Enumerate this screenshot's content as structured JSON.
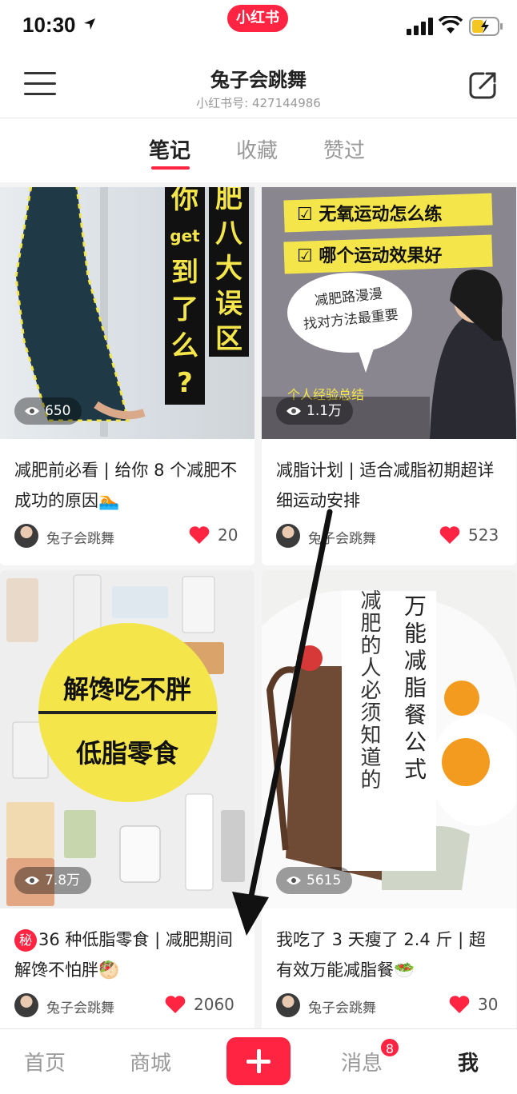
{
  "status_bar": {
    "time": "10:30",
    "brand": "小红书"
  },
  "header": {
    "name": "兔子会跳舞",
    "redbook_id": "小红书号: 427144986"
  },
  "tabs": [
    {
      "label": "笔记",
      "active": true
    },
    {
      "label": "收藏",
      "active": false
    },
    {
      "label": "赞过",
      "active": false
    }
  ],
  "cards": [
    {
      "views": "650",
      "title": "减肥前必看 | 给你 8 个减肥不成功的原因🏊",
      "author": "兔子会跳舞",
      "likes": "20",
      "cover_text": [
        "你",
        "get",
        "到",
        "了",
        "么",
        "?"
      ],
      "cover_text_b": [
        "肥",
        "八",
        "大",
        "误",
        "区"
      ]
    },
    {
      "views": "1.1万",
      "title": "减脂计划 | 适合减脂初期超详细运动安排",
      "author": "兔子会跳舞",
      "likes": "523",
      "cover_lines": [
        "无氧运动怎么练",
        "哪个运动效果好"
      ],
      "cover_bubble": [
        "减肥路漫漫",
        "找对方法最重要"
      ],
      "cover_footer": "个人经验总结"
    },
    {
      "views": "7.8万",
      "title_badge": "秘",
      "title": "36 种低脂零食 | 减肥期间解馋不怕胖🥙",
      "author": "兔子会跳舞",
      "likes": "2060",
      "cover_text": [
        "解馋吃不胖",
        "低脂零食"
      ]
    },
    {
      "views": "5615",
      "title": "我吃了 3 天瘦了 2.4 斤 | 超有效万能减脂餐🥗",
      "author": "兔子会跳舞",
      "likes": "30",
      "cover_vertical": [
        "减肥的人必须知道的",
        "万能减脂餐公式"
      ]
    }
  ],
  "bottom_nav": {
    "home": "首页",
    "mall": "商城",
    "messages": "消息",
    "messages_badge": "8",
    "me": "我"
  },
  "colors": {
    "brand": "#ff2442",
    "highlight": "#f4e64a"
  },
  "icons": [
    "location-arrow-icon",
    "signal-icon",
    "wifi-icon",
    "battery-charging-icon",
    "menu-icon",
    "share-icon",
    "eye-icon",
    "heart-icon",
    "plus-icon",
    "annotation-arrow"
  ]
}
